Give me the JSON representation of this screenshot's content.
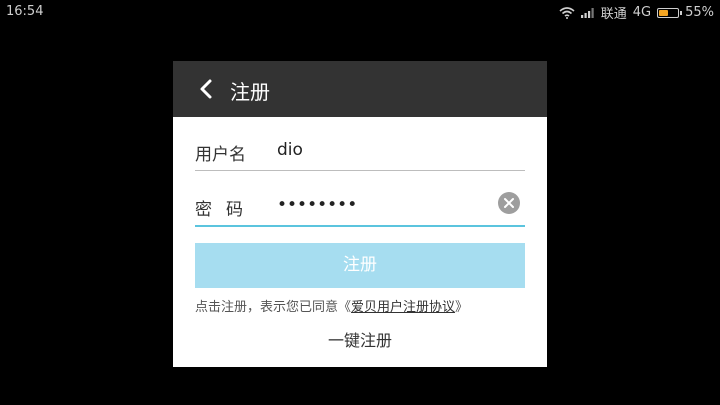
{
  "status": {
    "time": "16:54",
    "carrier": "联通",
    "network": "4G",
    "battery": "55%",
    "battery_level": 0.55
  },
  "dialog": {
    "title": "注册",
    "username": {
      "label": "用户名",
      "value": "dio"
    },
    "password": {
      "label_chars": [
        "密",
        "码"
      ],
      "value": "••••••••"
    },
    "register_label": "注册",
    "agreement": {
      "prefix": "点击注册，表示您已同意《",
      "link": "爱贝用户注册协议",
      "suffix": "》"
    },
    "quick_register": "一键注册"
  }
}
